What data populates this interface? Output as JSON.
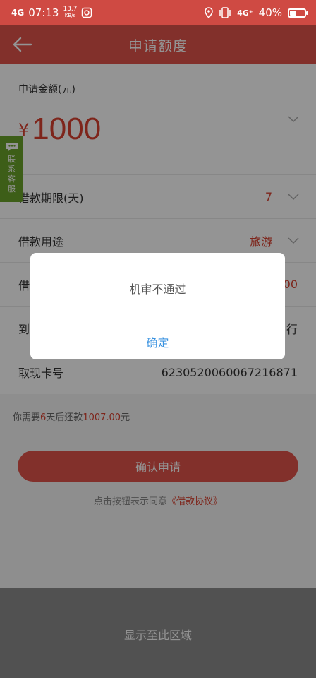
{
  "status_bar": {
    "signal": "4G",
    "time": "07:13",
    "speed_value": "13.7",
    "speed_unit": "KB/s",
    "network": "4G⁺",
    "battery_text": "40%",
    "battery_level": 0.4
  },
  "header": {
    "title": "申请额度"
  },
  "form": {
    "amount_label": "申请金额(元)",
    "currency": "¥",
    "amount": "1000",
    "rows": [
      {
        "label": "借款期限(天)",
        "value": "7"
      },
      {
        "label": "借款用途",
        "value": "旅游"
      },
      {
        "label": "借",
        "value": "00"
      },
      {
        "label": "到",
        "value": "行"
      },
      {
        "label": "取现卡号",
        "value": "6230520060067216871"
      }
    ]
  },
  "repay_note": {
    "prefix": "你需要",
    "days": "6",
    "middle": "天后还款",
    "amount": "1007.00",
    "suffix": "元"
  },
  "confirm_button": "确认申请",
  "agree_note": {
    "text": "点击按钮表示同意",
    "link": "《借款协议》"
  },
  "bottom_area": {
    "text": "显示至此区域"
  },
  "service_tab": {
    "chars": [
      "联",
      "系",
      "客",
      "服"
    ]
  },
  "dialog": {
    "message": "机审不通过",
    "ok_label": "确定"
  },
  "colors": {
    "brand": "#e0534a",
    "accent_text": "#d9412f",
    "link_blue": "#3b93e0",
    "service_green": "#6aa22a"
  }
}
